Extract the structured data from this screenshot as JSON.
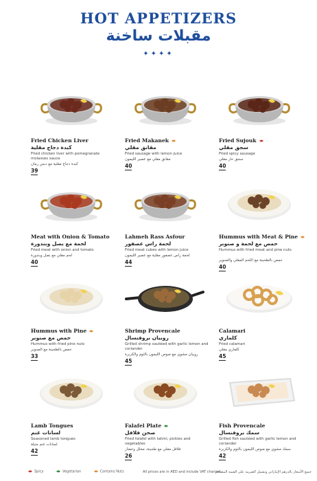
{
  "header": {
    "title": "HOT APPETIZERS",
    "title_ar": "مقبلات ساخنة",
    "stars": "✦✦✦✦"
  },
  "colors": {
    "brand_blue": "#1f4e9c",
    "spicy": "#c33a2e",
    "vegetarian": "#2f8a3d",
    "nuts": "#e08a2a"
  },
  "items": [
    {
      "name": "Fried Chicken Liver",
      "ar_name": "كبدة دجاج مقلية",
      "desc": "Fried chicken liver with pomegranate molasses sauce",
      "ar_desc": "كبدة دجاج مقلية مع دبس رمان",
      "price": "39",
      "tag": "",
      "dish": "pot",
      "food": "#6b2a1d"
    },
    {
      "name": "Fried Makanek",
      "ar_name": "مقانق مقلي",
      "desc": "Fried sausage with lemon juice",
      "ar_desc": "مقانق مقلي مع عصير الليمون",
      "price": "40",
      "tag": "nuts-icon",
      "dish": "pot",
      "food": "#6b3d22"
    },
    {
      "name": "Fried Sujouk",
      "ar_name": "سجق مقلي",
      "desc": "Fried spicy sausage",
      "ar_desc": "سجق حار مقلي",
      "price": "40",
      "tag": "spicy-icon",
      "dish": "pot",
      "food": "#5a2618"
    },
    {
      "name": "Meat with Onion & Tomato",
      "ar_name": "لحمة مع بصل وبندورة",
      "desc": "Fried meat with onion and tomato",
      "ar_desc": "لحم مقلي مع بصل وبندورة",
      "price": "40",
      "tag": "",
      "dish": "pot",
      "food": "#a9391f"
    },
    {
      "name": "Lahmeh Rass Asfour",
      "ar_name": "لحمة راس عصفور",
      "desc": "Fried meat cubes with lemon juice",
      "ar_desc": "لحمة راس عصفور مقلية مع عصير الليمون",
      "price": "44",
      "tag": "",
      "dish": "pot",
      "food": "#7a3f24"
    },
    {
      "name": "Hummus with Meat & Pine",
      "ar_name": "حمص مع لحمة و صنوبر",
      "desc": "Hummus with fried meat and pine nuts",
      "ar_desc": "حمص بالطحينة مع اللحم المقلي والصنوبر",
      "price": "40",
      "tag": "nuts-icon",
      "dish": "plate",
      "food": "#6b4328"
    },
    {
      "name": "Hummus with Pine",
      "ar_name": "حمص مع صنوبر",
      "desc": "Hummus with fried pine nuts",
      "ar_desc": "حمص بالطحينة مع الصنوبر",
      "price": "33",
      "tag": "nuts-icon",
      "dish": "plate",
      "food": "#e7d3a8"
    },
    {
      "name": "Shrimp Provencale",
      "ar_name": "روبيان بروفنسال",
      "desc": "Grilled shrimp sautéed with garlic lemon and coriander",
      "ar_desc": "روبيان مشوي مع صوص الليمون بالثوم والكزبرة",
      "price": "45",
      "tag": "",
      "dish": "pan",
      "food": "#9a6a3a"
    },
    {
      "name": "Calamari",
      "ar_name": "كلماري",
      "desc": "Fried calamari",
      "ar_desc": "كلماري مقلي",
      "price": "45",
      "tag": "",
      "dish": "oval",
      "food": "#d8a050"
    },
    {
      "name": "Lamb Tongues",
      "ar_name": "لسانات غنم",
      "desc": "Seasoned lamb tongues",
      "ar_desc": "لسانات غنم متبلة",
      "price": "42",
      "tag": "",
      "dish": "plate",
      "food": "#7c5a38"
    },
    {
      "name": "Falafel Plate",
      "ar_name": "صحن فلافل",
      "desc": "Fried falafel with tahini, pickles and vegetables",
      "ar_desc": "فلافل مقلي مع طحينة، مخلل وخضار",
      "price": "26",
      "tag": "vegetarian-icon",
      "dish": "plate",
      "food": "#8a4a22"
    },
    {
      "name": "Fish Provencale",
      "ar_name": "سمك بروفنسال",
      "desc": "Grilled fish sautéed with garlic lemon and coriander",
      "ar_desc": "سمك مشوي مع صوص الليمون بالثوم والكزبرة",
      "price": "42",
      "tag": "",
      "dish": "tray",
      "food": "#c98a52"
    }
  ],
  "legend": [
    {
      "icon": "spicy-icon",
      "label": "Spicy"
    },
    {
      "icon": "vegetarian-icon",
      "label": "Vegetarian"
    },
    {
      "icon": "nuts-icon",
      "label": "Contains Nuts"
    }
  ],
  "footer": {
    "note": "All prices are in AED and include VAT charges",
    "note_ar": "جميع الأسعار بالدرهم الإماراتي وتشمل الضريبة على القيمة المضافة"
  }
}
